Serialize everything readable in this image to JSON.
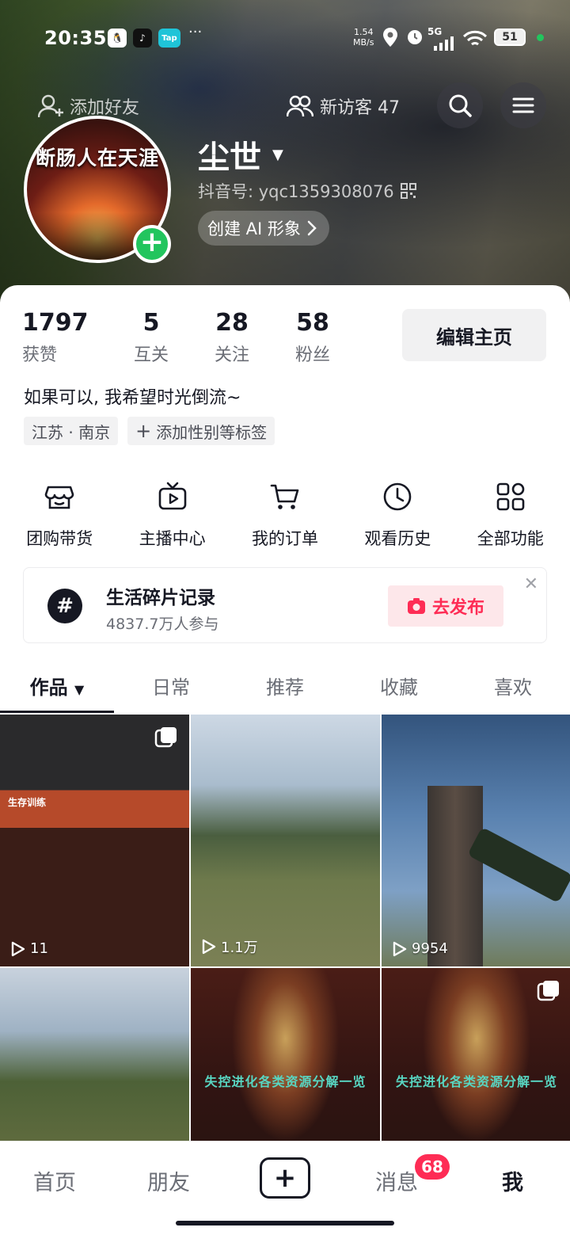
{
  "status_bar": {
    "time": "20:35",
    "apps": [
      "QQ",
      "TikTok",
      "Tap"
    ],
    "more": "···",
    "net_speed_value": "1.54",
    "net_speed_unit": "MB/s",
    "network": "5G",
    "battery": "51"
  },
  "header": {
    "add_friend_label": "添加好友",
    "visitors_label": "新访客 47",
    "avatar_caption": "断肠人在天涯",
    "nickname": "尘世",
    "douyin_id": "抖音号: yqc1359308076",
    "ai_button_label": "创建 AI 形象"
  },
  "stats": [
    {
      "value": "1797",
      "label": "获赞"
    },
    {
      "value": "5",
      "label": "互关"
    },
    {
      "value": "28",
      "label": "关注"
    },
    {
      "value": "58",
      "label": "粉丝"
    }
  ],
  "edit_profile_label": "编辑主页",
  "bio": "如果可以, 我希望时光倒流~",
  "tags": [
    "江苏 · 南京",
    "添加性别等标签"
  ],
  "features": [
    {
      "label": "团购带货",
      "icon": "shop-icon"
    },
    {
      "label": "主播中心",
      "icon": "tv-icon"
    },
    {
      "label": "我的订单",
      "icon": "cart-icon"
    },
    {
      "label": "观看历史",
      "icon": "clock-icon"
    },
    {
      "label": "全部功能",
      "icon": "apps-icon"
    }
  ],
  "topic_card": {
    "title": "生活碎片记录",
    "participants": "4837.7万人参与",
    "publish_label": "去发布"
  },
  "tabs": [
    "作品",
    "日常",
    "推荐",
    "收藏",
    "喜欢"
  ],
  "videos": [
    {
      "views": "11",
      "overlay_head": "生存训练",
      "multi": true
    },
    {
      "views": "1.1万",
      "overlay_head": "",
      "multi": false
    },
    {
      "views": "9954",
      "overlay_head": "",
      "multi": false
    },
    {
      "views": "",
      "overlay_head": "",
      "multi": false
    },
    {
      "views": "",
      "overlay_title": "失控进化各类资源分解一览",
      "multi": false
    },
    {
      "views": "",
      "overlay_title": "失控进化各类资源分解一览",
      "multi": true
    }
  ],
  "bottom_nav": {
    "home": "首页",
    "friends": "朋友",
    "plus": "+",
    "messages": "消息",
    "messages_badge": "68",
    "me": "我"
  }
}
